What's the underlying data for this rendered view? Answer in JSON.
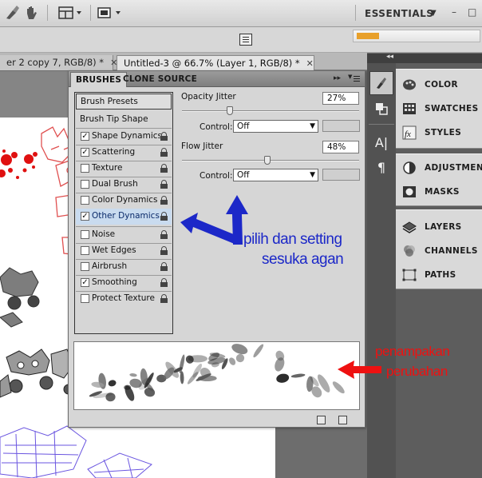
{
  "app": {
    "workspace_label": "ESSENTIALS",
    "workspace_caret": "▼",
    "win_minimize": "–",
    "win_restore": "□"
  },
  "doc_tabs": [
    {
      "label": "er 2 copy 7, RGB/8) *",
      "close": "✕"
    },
    {
      "label": "Untitled-3 @ 66.7% (Layer 1, RGB/8) *",
      "close": "✕"
    }
  ],
  "brushes_panel": {
    "tabs": [
      "BRUSHES",
      "CLONE SOURCE"
    ],
    "collapse_glyph": "▸▸",
    "list_items": [
      {
        "label": "Brush Presets",
        "type": "header"
      },
      {
        "label": "Brush Tip Shape",
        "type": "header"
      },
      {
        "label": "Shape Dynamics",
        "checked": true
      },
      {
        "label": "Scattering",
        "checked": true
      },
      {
        "label": "Texture",
        "checked": false
      },
      {
        "label": "Dual Brush",
        "checked": false
      },
      {
        "label": "Color Dynamics",
        "checked": false
      },
      {
        "label": "Other Dynamics",
        "checked": true,
        "selected": true
      },
      {
        "label": "Noise",
        "checked": false
      },
      {
        "label": "Wet Edges",
        "checked": false
      },
      {
        "label": "Airbrush",
        "checked": false
      },
      {
        "label": "Smoothing",
        "checked": true
      },
      {
        "label": "Protect Texture",
        "checked": false
      }
    ],
    "check_glyph": "✓",
    "opacity_jitter": {
      "label": "Opacity Jitter",
      "value": "27%",
      "slider": 0.27
    },
    "opacity_control": {
      "label": "Control:",
      "value": "Off",
      "caret": "▼"
    },
    "flow_jitter": {
      "label": "Flow Jitter",
      "value": "48%",
      "slider": 0.48
    },
    "flow_control": {
      "label": "Control:",
      "value": "Off",
      "caret": "▼"
    }
  },
  "dock": {
    "collapse_glyph": "◂◂",
    "groups": [
      [
        "COLOR",
        "SWATCHES",
        "STYLES"
      ],
      [
        "ADJUSTMENTS",
        "MASKS"
      ],
      [
        "LAYERS",
        "CHANNELS",
        "PATHS"
      ]
    ],
    "side_icons": [
      "brush-icon",
      "clone-source-icon",
      "character-icon",
      "paragraph-icon"
    ],
    "side_glyphs": [
      "A|",
      "¶"
    ]
  },
  "annotations": [
    {
      "text": "pilih dan setting",
      "color": "#1c28c8"
    },
    {
      "text": "sesuka agan",
      "color": "#1c28c8"
    },
    {
      "text": "penampakan",
      "color": "#ee1111"
    },
    {
      "text": "perubahan",
      "color": "#ee1111"
    }
  ],
  "colors": {
    "annotation_blue": "#1c28c8",
    "annotation_red": "#ee1111",
    "paint_red": "#e01010",
    "sketch_red": "#e05050",
    "sketch_violet": "#6a55e0"
  }
}
